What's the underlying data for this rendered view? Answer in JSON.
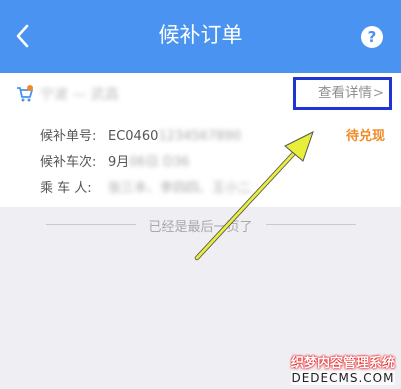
{
  "header": {
    "title": "候补订单",
    "back_icon": "chevron-left-icon",
    "help_icon": "question-circle-icon",
    "help_glyph": "?"
  },
  "order": {
    "cart_icon": "cart-icon",
    "route": "宁波 — 武昌",
    "detail_label": "查看详情",
    "detail_chevron": ">",
    "fields": [
      {
        "label": "候补单号:",
        "value": "EC0460",
        "value_blurred": "1234567890"
      },
      {
        "label": "候补车次:",
        "value": "9月",
        "value_blurred": "06日 D36"
      },
      {
        "label": "乘 车 人:",
        "value": "",
        "value_blurred": "张三丰、李四四、王小二"
      }
    ],
    "status": "待兑现"
  },
  "footer": {
    "end_text": "已经是最后一页了"
  },
  "watermark": {
    "line1": "织梦内容管理系统",
    "line2": "DEDECMS.COM"
  },
  "colors": {
    "header_bg": "#4a93f0",
    "status": "#f08a24",
    "highlight_box": "#2033d6",
    "arrow": "#e8ee3a"
  }
}
